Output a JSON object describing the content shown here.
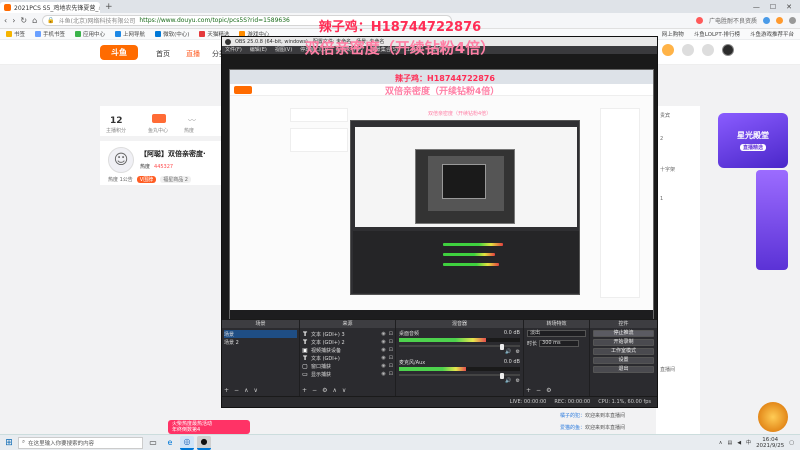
{
  "browser": {
    "tab_title": "2021PCS S5_鸡地农先锋夏营_斗...",
    "new_tab": "+",
    "site_badge": "斗鱼(北京)网络科技有限公司",
    "url": "https://www.douyu.com/topic/pcs5S?rid=1589636",
    "right_text": "广电胜耐不良资质",
    "window_controls": [
      "—",
      "☐",
      "✕"
    ]
  },
  "bookmarks": {
    "items": [
      "书签",
      "手机书签",
      "应用中心",
      "上网导航",
      "微软(中心)",
      "天猫精选",
      "游戏中心"
    ],
    "right_items": [
      "网上购物",
      "斗鱼LOLPT·排行榜",
      "斗鱼游戏推荐平台"
    ]
  },
  "douyu": {
    "nav": [
      "首页",
      "直播",
      "分类"
    ],
    "active_nav": 1,
    "room": {
      "level": "12",
      "level_label": "主播积分",
      "badge_label": "鱼丸中心",
      "wave_label": "热度"
    },
    "streamer": {
      "title": "【阿聪】双倍亲密度·",
      "tag1": "热度",
      "tag2": "445327",
      "bottom1": "热度 1公告",
      "pill1": "V围脖",
      "pill2": "福星商品 2"
    },
    "right_lines": [
      "贵宾",
      "2",
      "十字架",
      "1",
      "直播间"
    ],
    "chat": [
      {
        "nick": "橘子的犯：",
        "msg": "欢迎来到本直播间"
      },
      {
        "nick": "爱猫的鱼：",
        "msg": "欢迎来到本直播间"
      }
    ],
    "promo_title": "星光殿堂",
    "promo_sub": "直播精选",
    "pink_stamp_l1": "火柴热度最热活动",
    "pink_stamp_l2": "年终倒数第4",
    "mascot": "球球推荐"
  },
  "obs": {
    "title": "OBS 25.0.8 (64-bit, windows) - 配置文件: 未命名 - 场景: 未命名",
    "menu": [
      "文件(F)",
      "编辑(E)",
      "视图(V)",
      "停靠窗口(D)",
      "配置文件(P)",
      "场景集合(S)",
      "工具(T)",
      "帮助(H)"
    ],
    "docks": {
      "scenes": {
        "title": "场景",
        "items": [
          "场景",
          "场景 2"
        ]
      },
      "sources": {
        "title": "来源",
        "items": [
          {
            "icon": "T",
            "name": "文本 (GDI+) 3"
          },
          {
            "icon": "T",
            "name": "文本 (GDI+) 2"
          },
          {
            "icon": "▣",
            "name": "视频捕获设备"
          },
          {
            "icon": "T",
            "name": "文本 (GDI+)"
          },
          {
            "icon": "▢",
            "name": "窗口捕获"
          },
          {
            "icon": "▭",
            "name": "显示捕获"
          }
        ]
      },
      "mixer": {
        "title": "混音器",
        "channels": [
          {
            "name": "桌面音频",
            "db": "0.0 dB",
            "level": 0.72
          },
          {
            "name": "麦克风/Aux",
            "db": "0.0 dB",
            "level": 0.55
          }
        ]
      },
      "transitions": {
        "title": "转场特效",
        "mode": "淡出",
        "duration_label": "时长",
        "duration_value": "300 ms"
      },
      "controls": {
        "title": "控件",
        "buttons": [
          "停止推流",
          "开始录制",
          "工作室模式",
          "设置",
          "退出"
        ]
      }
    },
    "status": {
      "live": "LIVE: 00:00:00",
      "rec": "REC: 00:00:00",
      "cpu": "CPU: 1.1%, 60.00 fps"
    }
  },
  "overlay": {
    "line1": "辣子鸡：H18744722876",
    "line2": "双倍亲密度（开续钻粉4倍）"
  },
  "taskbar": {
    "search_placeholder": "在这里输入你要搜索的内容",
    "time": "16:04",
    "date": "2021/9/25"
  }
}
